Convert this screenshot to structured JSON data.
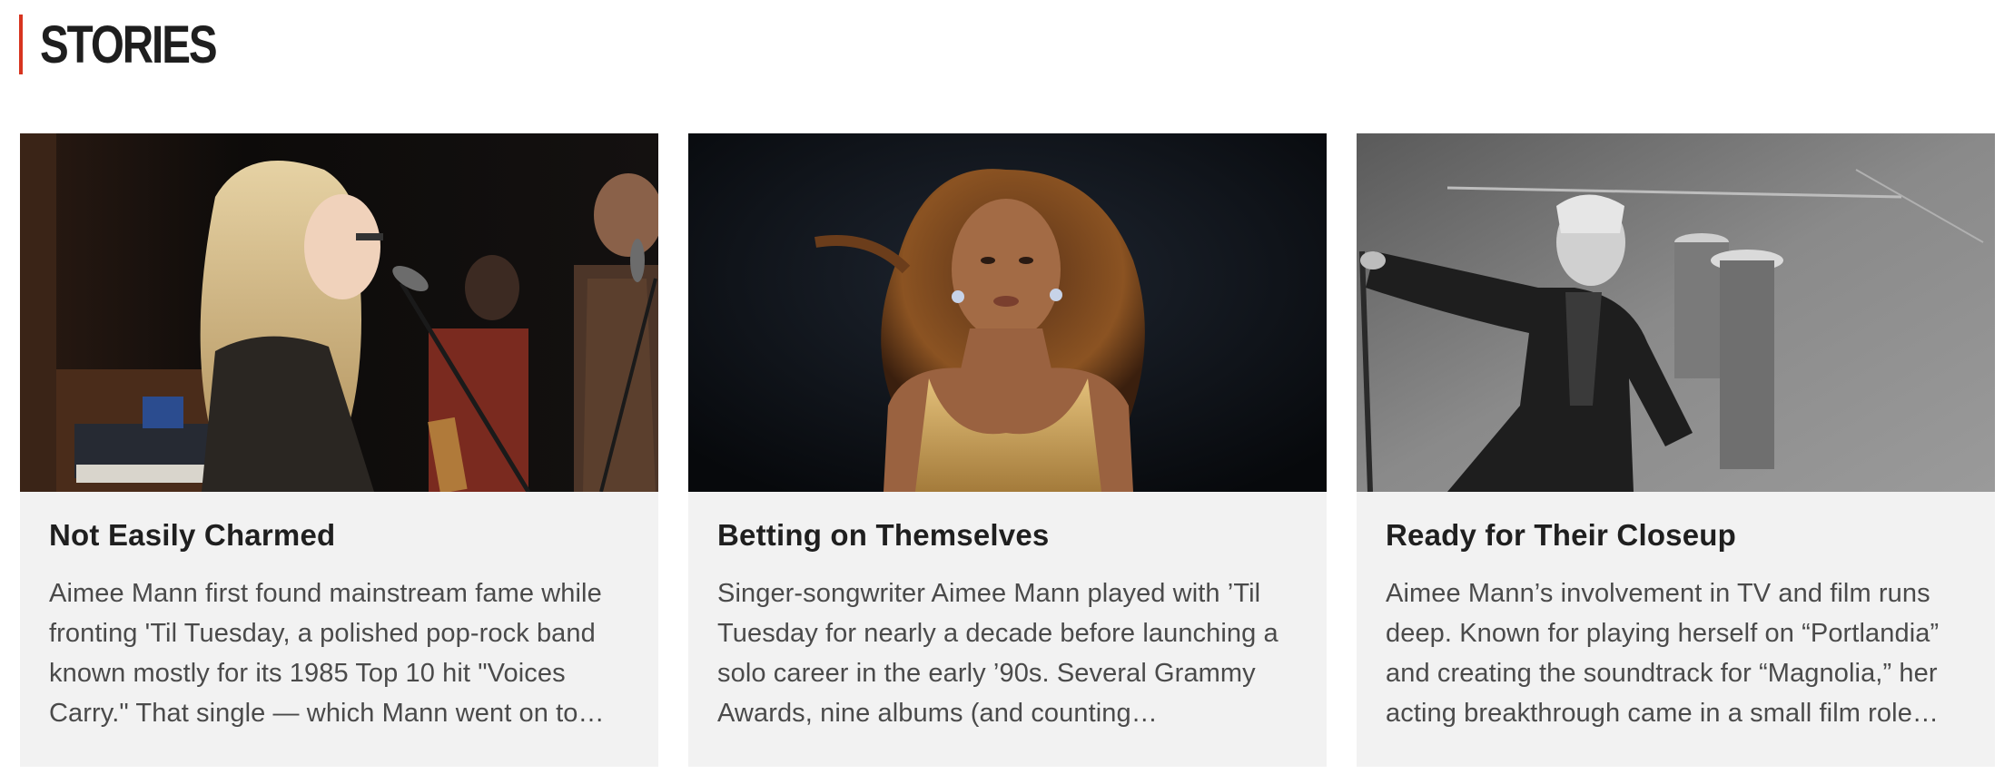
{
  "section": {
    "title": "STORIES",
    "accent_color": "#d7341f"
  },
  "stories": [
    {
      "title": "Not Easily Charmed",
      "excerpt": "Aimee Mann first found mainstream fame while fronting 'Til Tuesday, a polished pop-rock band known mostly for its 1985 Top 10 hit \"Voices Carry.\" That single — which Mann went on to write and sing…",
      "image": "band-performing-in-studio-photo"
    },
    {
      "title": "Betting on Themselves",
      "excerpt": "Singer-songwriter Aimee Mann played with ’Til Tuesday for nearly a decade before launching a solo career in the early ’90s. Several Grammy Awards, nine albums (and counting…",
      "image": "singer-in-gold-dress-on-stage-photo"
    },
    {
      "title": "Ready for Their Closeup",
      "excerpt": "Aimee Mann’s involvement in TV and film runs deep. Known for playing herself on “Portlandia” and creating the soundtrack for “Magnolia,” her acting breakthrough came in a small film role…",
      "image": "black-and-white-rock-performer-photo"
    }
  ]
}
